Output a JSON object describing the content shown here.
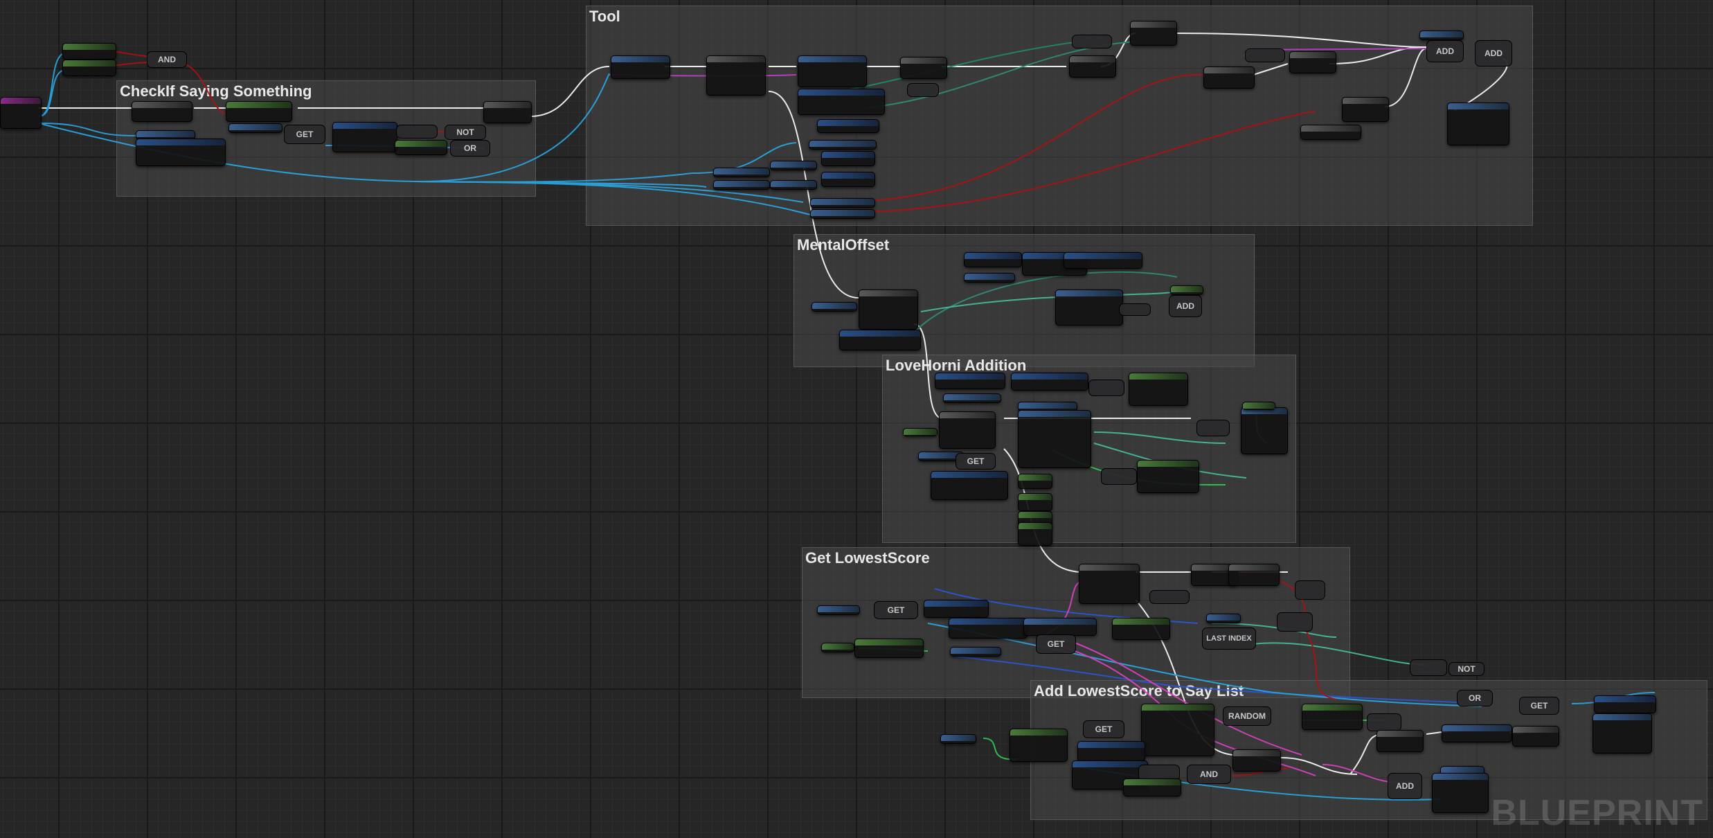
{
  "graph": {
    "comments": [
      {
        "id": "tool",
        "title": "Tool"
      },
      {
        "id": "checkif",
        "title": "CheckIf Saying Something"
      },
      {
        "id": "mental",
        "title": "MentalOffset"
      },
      {
        "id": "lovehorni",
        "title": "LoveHorni Addition"
      },
      {
        "id": "lowest",
        "title": "Get LowestScore"
      },
      {
        "id": "addlowest",
        "title": "Add LowestScore to Say List"
      }
    ],
    "ops": {
      "and": "AND",
      "get": "GET",
      "not": "NOT",
      "or": "OR",
      "add": "ADD",
      "random": "RANDOM",
      "last_index": "LAST INDEX"
    },
    "watermark": "BLUEPRINT"
  }
}
